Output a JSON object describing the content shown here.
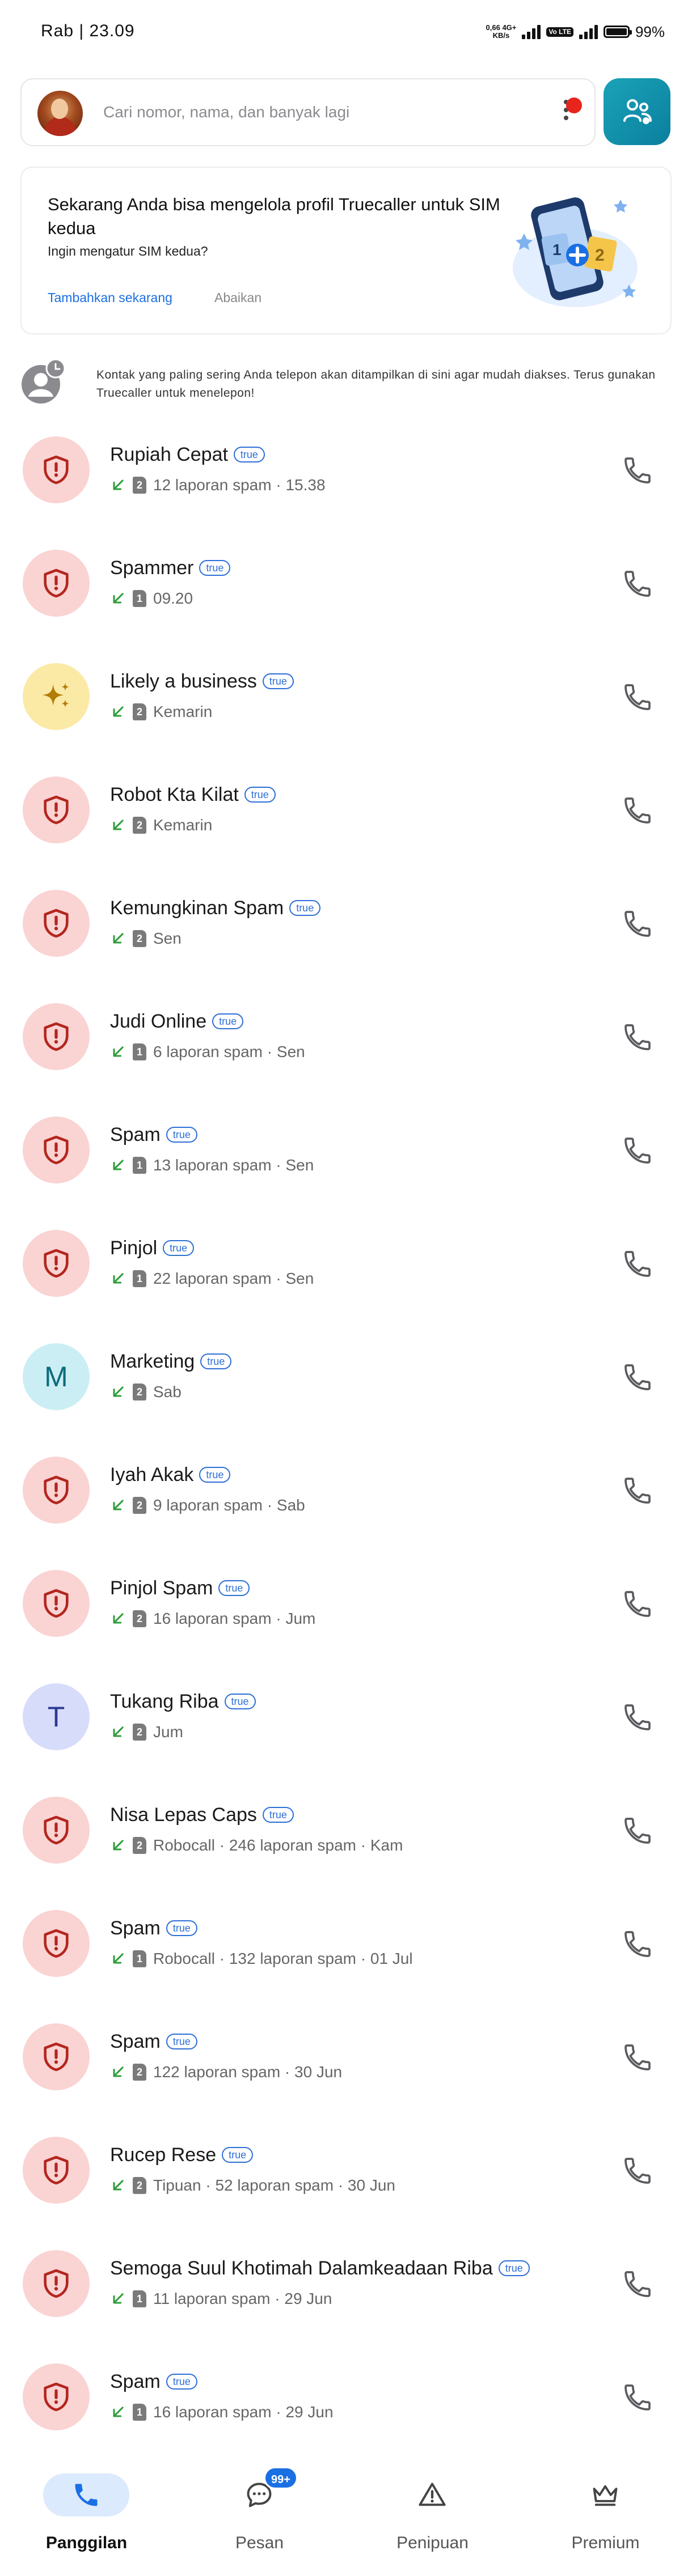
{
  "status_bar": {
    "time": "Rab | 23.09",
    "net_speed_value": "0,66",
    "net_speed_unit": "KB/s",
    "network_type": "4G+",
    "volte_label": "Vo LTE",
    "battery": "99%"
  },
  "search": {
    "placeholder": "Cari nomor, nama, dan banyak lagi"
  },
  "banner": {
    "title": "Sekarang Anda bisa mengelola profil Truecaller untuk SIM kedua",
    "subtitle": "Ingin mengatur SIM kedua?",
    "primary_action": "Tambahkan sekarang",
    "secondary_action": "Abaikan"
  },
  "info": {
    "text": "Kontak yang paling sering Anda telepon akan ditampilkan di sini agar mudah diakses. Terus gunakan Truecaller untuk menelepon!"
  },
  "calls": [
    {
      "name": "Rupiah Cepat",
      "badge": "true",
      "sim": "2",
      "meta": "12 laporan spam · 15.38",
      "avatar": "spam"
    },
    {
      "name": "Spammer",
      "badge": "true",
      "sim": "1",
      "meta": "09.20",
      "avatar": "spam"
    },
    {
      "name": "Likely a business",
      "badge": "true",
      "sim": "2",
      "meta": "Kemarin",
      "avatar": "business"
    },
    {
      "name": "Robot Kta Kilat",
      "badge": "true",
      "sim": "2",
      "meta": "Kemarin",
      "avatar": "spam"
    },
    {
      "name": "Kemungkinan Spam",
      "badge": "true",
      "sim": "2",
      "meta": "Sen",
      "avatar": "spam"
    },
    {
      "name": "Judi Online",
      "badge": "true",
      "sim": "1",
      "meta": "6 laporan spam · Sen",
      "avatar": "spam"
    },
    {
      "name": "Spam",
      "badge": "true",
      "sim": "1",
      "meta": "13 laporan spam · Sen",
      "avatar": "spam"
    },
    {
      "name": "Pinjol",
      "badge": "true",
      "sim": "1",
      "meta": "22 laporan spam · Sen",
      "avatar": "spam"
    },
    {
      "name": "Marketing",
      "badge": "true",
      "sim": "2",
      "meta": "Sab",
      "avatar": "letter",
      "letter": "M"
    },
    {
      "name": "Iyah Akak",
      "badge": "true",
      "sim": "2",
      "meta": "9 laporan spam · Sab",
      "avatar": "spam"
    },
    {
      "name": "Pinjol Spam",
      "badge": "true",
      "sim": "2",
      "meta": "16 laporan spam · Jum",
      "avatar": "spam"
    },
    {
      "name": "Tukang Riba",
      "badge": "true",
      "sim": "2",
      "meta": "Jum",
      "avatar": "letter",
      "letter": "T"
    },
    {
      "name": "Nisa Lepas Caps",
      "badge": "true",
      "sim": "2",
      "meta": "Robocall · 246 laporan spam · Kam",
      "avatar": "spam"
    },
    {
      "name": "Spam",
      "badge": "true",
      "sim": "1",
      "meta": "Robocall · 132 laporan spam · 01 Jul",
      "avatar": "spam"
    },
    {
      "name": "Spam",
      "badge": "true",
      "sim": "2",
      "meta": "122 laporan spam · 30 Jun",
      "avatar": "spam"
    },
    {
      "name": "Rucep Rese",
      "badge": "true",
      "sim": "2",
      "meta": "Tipuan · 52 laporan spam · 30 Jun",
      "avatar": "spam"
    },
    {
      "name": "Semoga Suul Khotimah Dalamkeadaan Riba",
      "badge": "true",
      "sim": "1",
      "meta": "11 laporan spam · 29 Jun",
      "avatar": "spam"
    },
    {
      "name": "Spam",
      "badge": "true",
      "sim": "1",
      "meta": "16 laporan spam · 29 Jun",
      "avatar": "spam"
    }
  ],
  "icons": {
    "spam_avatar": "shield-alert-icon",
    "business_avatar": "sparkle-icon",
    "call_direction": "incoming-arrow-icon",
    "call_action": "phone-icon"
  },
  "colors": {
    "accent": "#1a6fe3",
    "spam_bg": "#fad3d3",
    "spam_icon": "#b3261e",
    "incoming_arrow": "#2e9e3a",
    "brand_teal": "#0b7f9e"
  },
  "nav": {
    "items": [
      {
        "label": "Panggilan",
        "icon": "phone-icon",
        "active": true
      },
      {
        "label": "Pesan",
        "icon": "message-icon",
        "badge": "99+"
      },
      {
        "label": "Penipuan",
        "icon": "warning-icon"
      },
      {
        "label": "Premium",
        "icon": "crown-icon"
      }
    ]
  }
}
